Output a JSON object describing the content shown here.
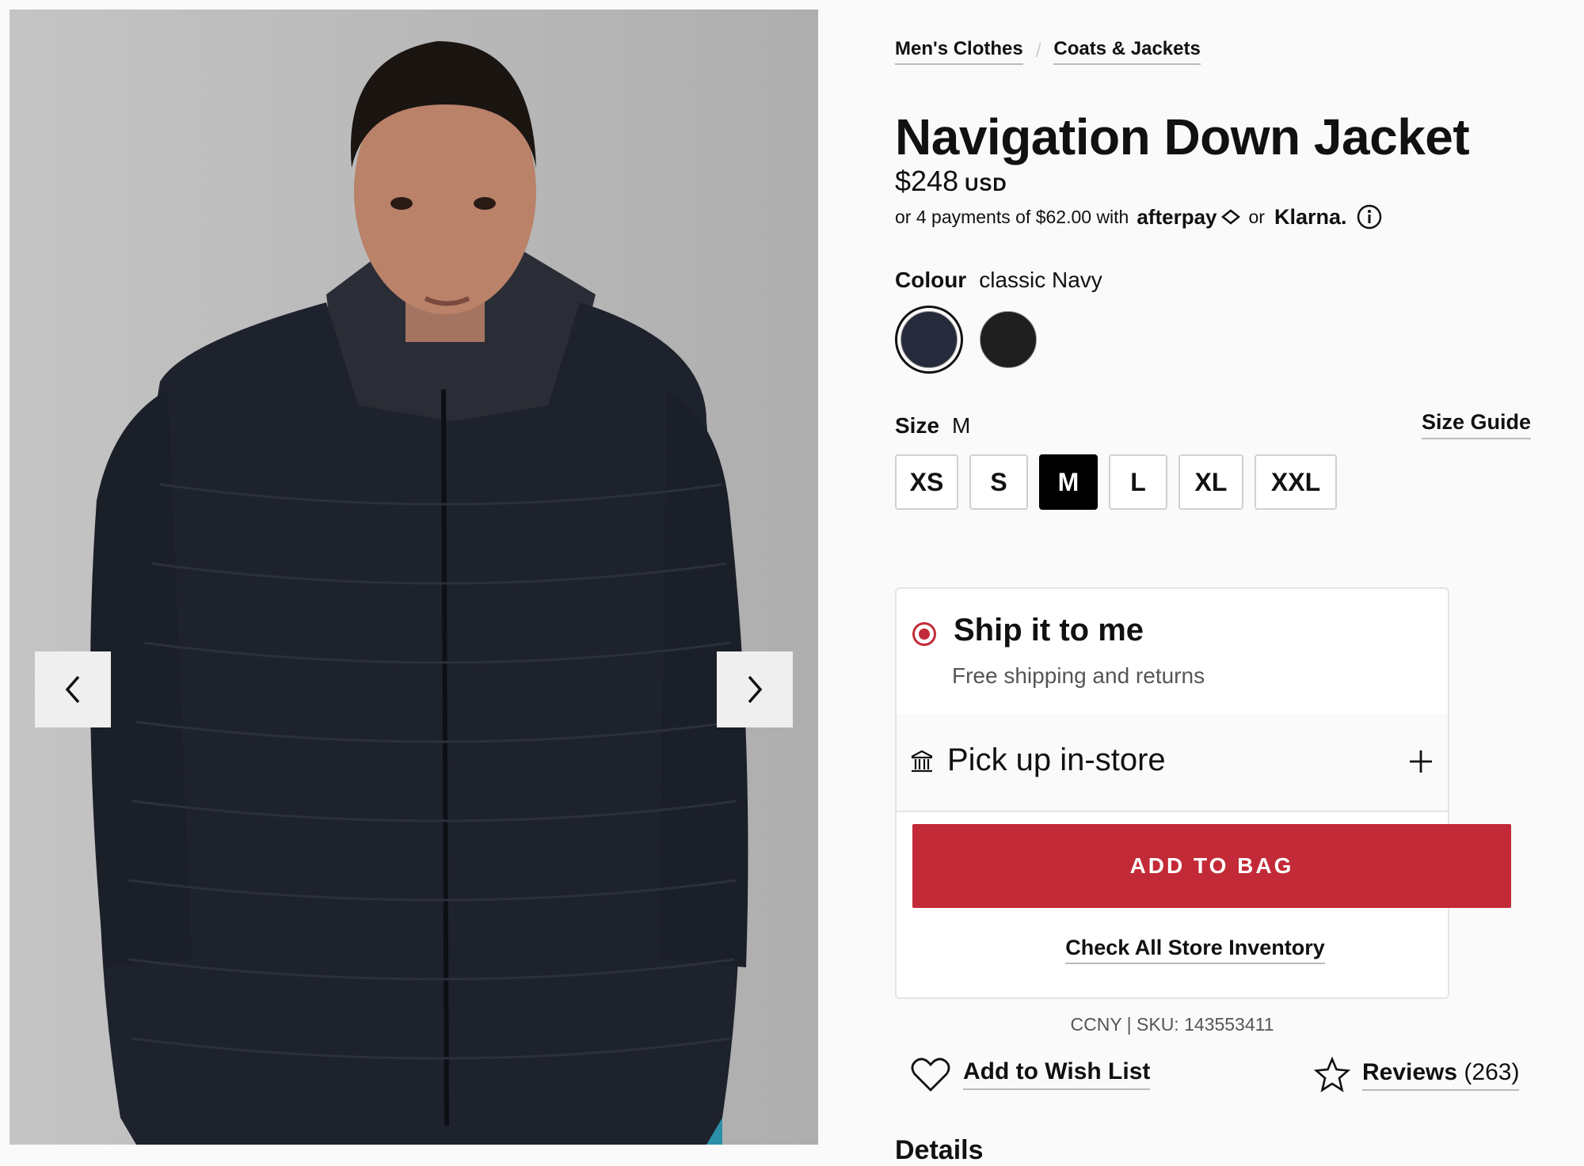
{
  "gallery": {
    "prev_icon": "chevron-left-icon",
    "next_icon": "chevron-right-icon"
  },
  "breadcrumb": [
    "Men's Clothes",
    "Coats & Jackets"
  ],
  "product": {
    "title": "Navigation Down Jacket",
    "price": "$248",
    "currency": "USD"
  },
  "payments": {
    "text": "or 4 payments of $62.00 with",
    "provider1": "afterpay",
    "or_text": "or",
    "provider2": "Klarna."
  },
  "colour": {
    "label": "Colour",
    "selected": "classic Navy",
    "swatches": [
      {
        "color": "#252b3b",
        "selected": true
      },
      {
        "color": "#1f1f1f",
        "selected": false
      }
    ]
  },
  "size": {
    "label": "Size",
    "selected": "M",
    "guide": "Size Guide",
    "options": [
      "XS",
      "S",
      "M",
      "L",
      "XL",
      "XXL"
    ]
  },
  "fulfilment": {
    "ship_title": "Ship it to me",
    "ship_subtitle": "Free shipping and returns",
    "pickup_title": "Pick up in-store",
    "add_to_bag": "ADD TO BAG",
    "inventory_link": "Check All Store Inventory"
  },
  "sku": "CCNY | SKU: 143553411",
  "wishlist": "Add to Wish List",
  "reviews": {
    "label": "Reviews",
    "count": "(263)"
  },
  "details_heading": "Details",
  "colors": {
    "accent": "#c32a37",
    "selected_size_bg": "#000000"
  }
}
